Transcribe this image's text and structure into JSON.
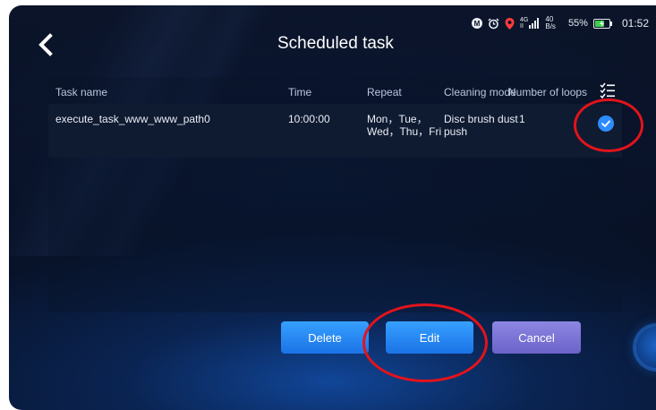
{
  "header": {
    "title": "Scheduled task"
  },
  "status_bar": {
    "network_top": "4G",
    "network_bottom": "II",
    "speed_value": "40",
    "speed_unit": "B/s",
    "battery": "55%",
    "time": "01:52"
  },
  "table": {
    "columns": {
      "name": "Task name",
      "time": "Time",
      "repeat": "Repeat",
      "mode": "Cleaning mode",
      "loops": "Number of loops"
    },
    "rows": [
      {
        "name": "execute_task_www_www_path0",
        "time": "10:00:00",
        "repeat": "Mon，Tue，Wed，Thu，Fri",
        "mode": "Disc brush dust push",
        "loops": "1",
        "selected": true
      }
    ]
  },
  "buttons": {
    "delete": "Delete",
    "edit": "Edit",
    "cancel": "Cancel"
  },
  "colors": {
    "accent": "#2d8cff",
    "cancel": "#7a72d6",
    "annotation": "#e3131b"
  },
  "icons": {
    "back": "chevron-left-icon",
    "select_all": "checklist-icon",
    "row_check": "check-circle-icon"
  }
}
